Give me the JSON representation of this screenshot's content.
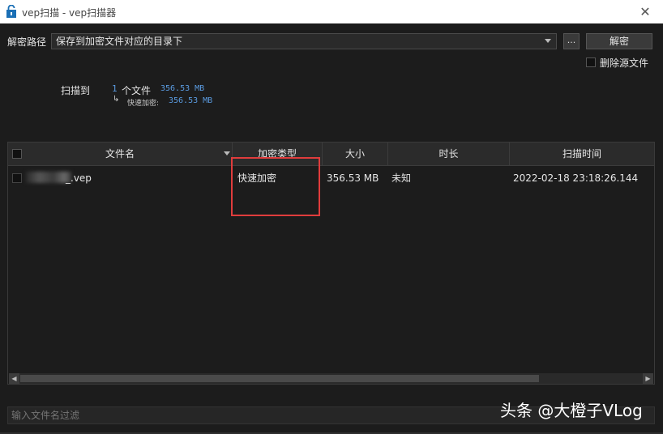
{
  "window": {
    "title": "vep扫描 - vep扫描器",
    "close_glyph": "✕",
    "icon": "lock-icon"
  },
  "toolbar": {
    "path_label": "解密路径",
    "path_value": "保存到加密文件对应的目录下",
    "browse_label": "...",
    "decrypt_label": "解密",
    "delete_source_label": "删除源文件"
  },
  "scan": {
    "label": "扫描到",
    "count": "1",
    "count_unit": "个文件",
    "total_size": "356.53 MB",
    "sub_arrow": "↳",
    "sub_label": "快速加密:",
    "sub_size": "356.53 MB"
  },
  "table": {
    "columns": [
      "文件名",
      "加密类型",
      "大小",
      "时长",
      "扫描时间"
    ],
    "rows": [
      {
        "filename": "_.vep",
        "enc_type": "快速加密",
        "size": "356.53 MB",
        "duration": "未知",
        "scan_time": "2022-02-18 23:18:26.144"
      }
    ]
  },
  "filter": {
    "placeholder": "输入文件名过滤"
  },
  "watermark": "头条 @大橙子VLog",
  "colors": {
    "background": "#1c1c1c",
    "header": "#2b2b2b",
    "accent_blue": "#5a9be0",
    "highlight_red": "#e03c3c"
  }
}
